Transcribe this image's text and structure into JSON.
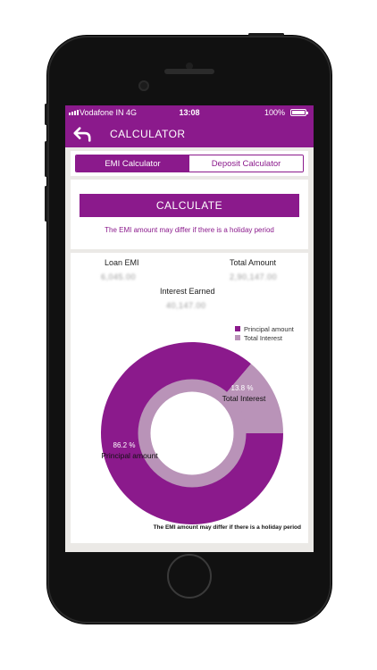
{
  "status_bar": {
    "carrier": "Vodafone IN   4G",
    "time": "13:08",
    "battery": "100%"
  },
  "app_bar": {
    "back_icon": "back-arrow-icon",
    "title": "CALCULATOR"
  },
  "tabs": [
    {
      "label": "EMI Calculator",
      "active": true
    },
    {
      "label": "Deposit Calculator",
      "active": false
    }
  ],
  "calculate": {
    "button_label": "CALCULATE",
    "note": "The EMI amount may differ if there is a holiday period"
  },
  "results": {
    "loan_emi_label": "Loan EMI",
    "loan_emi_value": "6,045.00",
    "total_amount_label": "Total Amount",
    "total_amount_value": "2,90,147.00",
    "interest_earned_label": "Interest Earned",
    "interest_earned_value": "40,147.00"
  },
  "chart_data": {
    "type": "pie",
    "style": "donut",
    "categories": [
      "Principal amount",
      "Total Interest"
    ],
    "values": [
      86.2,
      13.8
    ],
    "slice_labels": [
      "86.2 %",
      "13.8 %"
    ],
    "label_names": [
      "Principal amount",
      "Total Interest"
    ],
    "colors": [
      "#8b1a8c",
      "#b993b8"
    ],
    "legend_placement": "top-right"
  },
  "footer_note": "The EMI amount may differ if there is a holiday period",
  "colors": {
    "brand": "#8b1a8c",
    "secondary": "#b993b8",
    "background": "#ebe9e6"
  }
}
